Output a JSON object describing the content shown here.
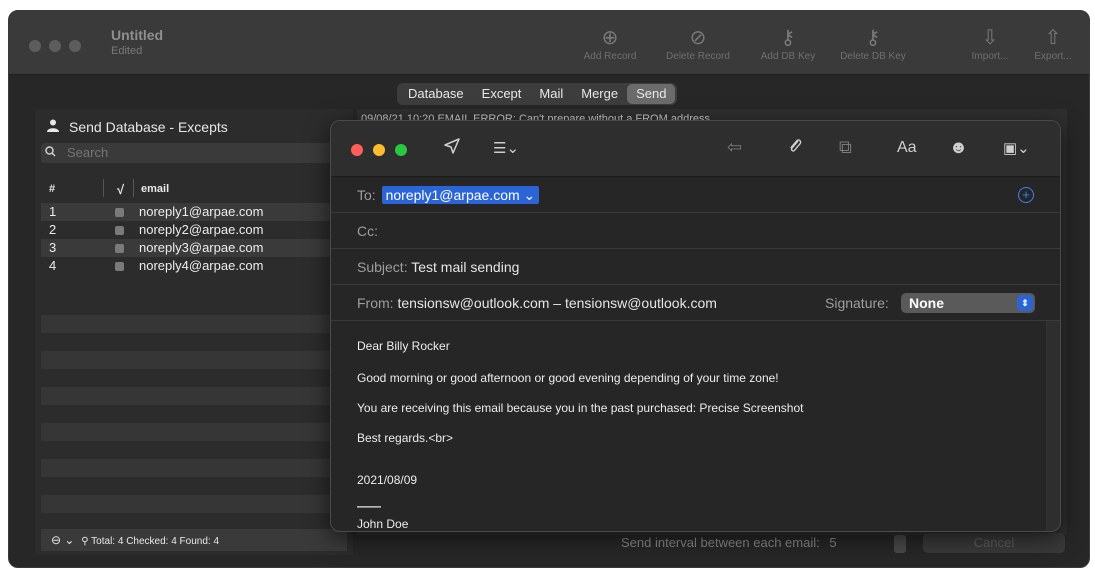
{
  "window": {
    "title": "Untitled",
    "subtitle": "Edited"
  },
  "toolbar": {
    "buttons": [
      {
        "label": "Add Record",
        "icon": "plus-circle-icon"
      },
      {
        "label": "Delete Record",
        "icon": "no-entry-icon"
      },
      {
        "label": "Add DB Key",
        "icon": "key-plus-icon"
      },
      {
        "label": "Delete DB Key",
        "icon": "key-minus-icon"
      },
      {
        "label": "Import...",
        "icon": "import-icon"
      },
      {
        "label": "Export...",
        "icon": "export-icon"
      }
    ]
  },
  "tabs": [
    {
      "label": "Database",
      "active": false
    },
    {
      "label": "Except",
      "active": false
    },
    {
      "label": "Mail",
      "active": false
    },
    {
      "label": "Merge",
      "active": false
    },
    {
      "label": "Send",
      "active": true
    }
  ],
  "left_panel": {
    "title": "Send Database - Excepts",
    "search_placeholder": "Search",
    "columns": {
      "num": "#",
      "check": "√",
      "email": "email"
    },
    "rows": [
      {
        "num": "1",
        "email": "noreply1@arpae.com"
      },
      {
        "num": "2",
        "email": "noreply2@arpae.com"
      },
      {
        "num": "3",
        "email": "noreply3@arpae.com"
      },
      {
        "num": "4",
        "email": "noreply4@arpae.com"
      }
    ],
    "footer": "Total: 4  Checked: 4  Found: 4"
  },
  "log": {
    "text": "09/08/21 10:20 EMAIL ERROR: Can't prepare without a FROM address"
  },
  "send_panel": {
    "interval_label": "Send interval between each email:",
    "interval_value": "5",
    "cancel_label": "Cancel"
  },
  "compose": {
    "to_label": "To:",
    "to_value": "noreply1@arpae.com ⌄",
    "cc_label": "Cc:",
    "subject_label": "Subject:",
    "subject_value": "Test mail sending",
    "from_label": "From:",
    "from_value": "tensionsw@outlook.com – tensionsw@outlook.com",
    "signature_label": "Signature:",
    "signature_value": "None",
    "font_button": "Aa",
    "body": {
      "line1": "Dear Billy Rocker",
      "line2": "Good morning or good afternoon or good evening depending of your time zone!",
      "line3": "You are receiving this email because you in the past purchased: Precise Screenshot",
      "line4": "Best regards.<br>",
      "line5": "2021/08/09",
      "line6": "——",
      "line7": "John Doe"
    }
  },
  "colors": {
    "accent_blue": "#2a64d6",
    "close_red": "#ff5f57",
    "minimize_yellow": "#febc2e",
    "zoom_green": "#28c840"
  }
}
